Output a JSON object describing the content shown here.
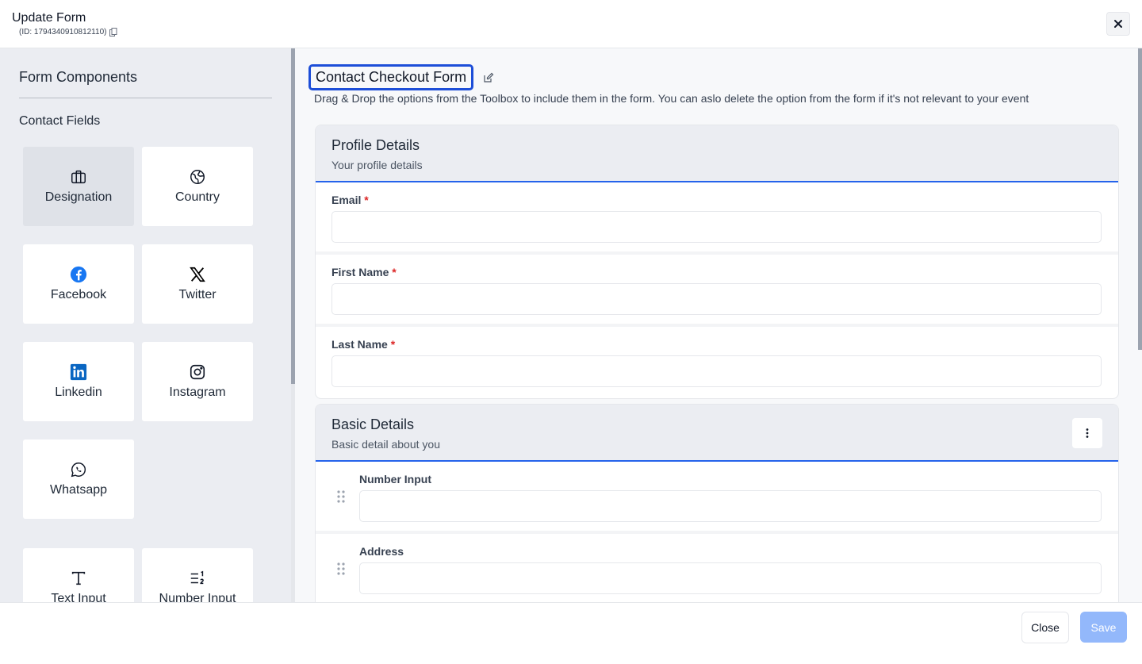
{
  "header": {
    "title": "Update Form",
    "id_label": "(ID: 1794340910812110)"
  },
  "sidebar": {
    "title": "Form Components",
    "section_contact": "Contact Fields",
    "tiles": [
      {
        "label": "Designation",
        "icon": "briefcase-icon"
      },
      {
        "label": "Country",
        "icon": "globe-icon"
      },
      {
        "label": "Facebook",
        "icon": "facebook-icon"
      },
      {
        "label": "Twitter",
        "icon": "x-twitter-icon"
      },
      {
        "label": "Linkedin",
        "icon": "linkedin-icon"
      },
      {
        "label": "Instagram",
        "icon": "instagram-icon"
      },
      {
        "label": "Whatsapp",
        "icon": "whatsapp-icon"
      },
      {
        "label": "Text Input",
        "icon": "text-icon"
      },
      {
        "label": "Number Input",
        "icon": "number-list-icon"
      }
    ]
  },
  "main": {
    "form_title": "Contact Checkout Form",
    "form_subtitle": "Drag & Drop the options from the Toolbox to include them in the form. You can aslo delete the option from the form if it's not relevant to your event",
    "profile": {
      "title": "Profile Details",
      "desc": "Your profile details",
      "fields": [
        {
          "label": "Email",
          "required": "*"
        },
        {
          "label": "First Name",
          "required": "*"
        },
        {
          "label": "Last Name",
          "required": "*"
        }
      ]
    },
    "basic": {
      "title": "Basic Details",
      "desc": "Basic detail about you",
      "fields": [
        {
          "label": "Number Input"
        },
        {
          "label": "Address"
        }
      ]
    }
  },
  "footer": {
    "close_label": "Close",
    "save_label": "Save"
  },
  "colors": {
    "accent": "#2563eb",
    "save_disabled": "#93b8fb",
    "required": "#dc2626"
  }
}
